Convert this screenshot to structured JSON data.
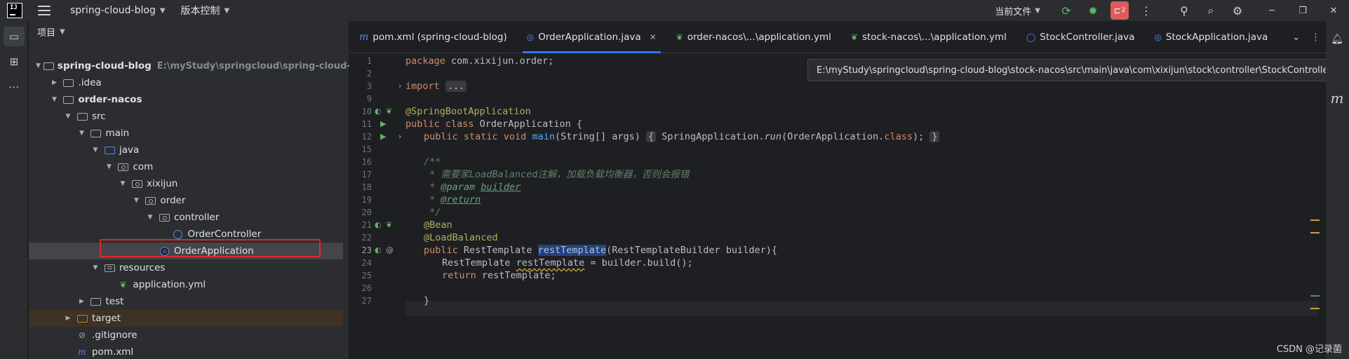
{
  "titlebar": {
    "logo_text": "IJ",
    "project_menu": "spring-cloud-blog",
    "vcs_menu": "版本控制",
    "run_config": "当前文件",
    "problems_badge": "2",
    "icons": [
      "menu-icon",
      "run-icon",
      "debug-icon",
      "more-icon",
      "add-user-icon",
      "search-icon",
      "settings-icon"
    ]
  },
  "project_panel": {
    "header": "项目",
    "tree": [
      {
        "label": "spring-cloud-blog",
        "secondary": "E:\\myStudy\\springcloud\\spring-cloud-blog",
        "depth": 0,
        "expanded": true,
        "icon": "module-folder-icon",
        "bold": true
      },
      {
        "label": ".idea",
        "depth": 1,
        "expanded": false,
        "icon": "folder-icon"
      },
      {
        "label": "order-nacos",
        "depth": 1,
        "expanded": true,
        "icon": "module-folder-icon",
        "bold": true
      },
      {
        "label": "src",
        "depth": 2,
        "expanded": true,
        "icon": "folder-icon"
      },
      {
        "label": "main",
        "depth": 3,
        "expanded": true,
        "icon": "folder-icon"
      },
      {
        "label": "java",
        "depth": 4,
        "expanded": true,
        "icon": "source-folder-icon"
      },
      {
        "label": "com",
        "depth": 5,
        "expanded": true,
        "icon": "package-icon"
      },
      {
        "label": "xixijun",
        "depth": 6,
        "expanded": true,
        "icon": "package-icon"
      },
      {
        "label": "order",
        "depth": 7,
        "expanded": true,
        "icon": "package-icon"
      },
      {
        "label": "controller",
        "depth": 8,
        "expanded": true,
        "icon": "package-icon"
      },
      {
        "label": "OrderController",
        "depth": 9,
        "icon": "class-icon"
      },
      {
        "label": "OrderApplication",
        "depth": 8,
        "icon": "spring-class-icon",
        "selected": true
      },
      {
        "label": "resources",
        "depth": 4,
        "expanded": true,
        "icon": "resources-folder-icon"
      },
      {
        "label": "application.yml",
        "depth": 5,
        "icon": "yml-file-icon"
      },
      {
        "label": "test",
        "depth": 3,
        "expanded": false,
        "icon": "folder-icon"
      },
      {
        "label": "target",
        "depth": 2,
        "expanded": false,
        "icon": "excluded-folder-icon",
        "target": true
      },
      {
        "label": ".gitignore",
        "depth": 2,
        "icon": "gitignore-icon"
      },
      {
        "label": "pom.xml",
        "depth": 2,
        "icon": "maven-icon"
      }
    ]
  },
  "tabs": [
    {
      "label": "pom.xml (spring-cloud-blog)",
      "icon": "m"
    },
    {
      "label": "OrderApplication.java",
      "icon": "spring",
      "active": true,
      "closable": true
    },
    {
      "label": "order-nacos\\...\\application.yml",
      "icon": "yml"
    },
    {
      "label": "stock-nacos\\...\\application.yml",
      "icon": "yml"
    },
    {
      "label": "StockController.java",
      "icon": "class"
    },
    {
      "label": "StockApplication.java",
      "icon": "spring"
    }
  ],
  "tooltip": "E:\\myStudy\\springcloud\\spring-cloud-blog\\stock-nacos\\src\\main\\java\\com\\xixijun\\stock\\controller\\StockController.java",
  "gutter_lines": [
    "1",
    "2",
    "3",
    "9",
    "10",
    "11",
    "12",
    "15",
    "16",
    "17",
    "18",
    "19",
    "20",
    "21",
    "22",
    "23",
    "24",
    "25",
    "26",
    "27"
  ],
  "current_line": "23",
  "code": {
    "l1_kw": "package",
    "l1_rest": " com.xixijun.order;",
    "l3_kw": "import",
    "l3_fold": "...",
    "l10": "@SpringBootApplication",
    "l11_kw": "public class",
    "l11_rest": " OrderApplication {",
    "l12_kw": "public static void",
    "l12_fn": "main",
    "l12_args": "(String[] args)",
    "l12_open": "{",
    "l12_body": " SpringApplication.",
    "l12_run": "run",
    "l12_tail": "(OrderApplication.",
    "l12_class": "class",
    "l12_end": "); ",
    "l12_close": "}",
    "l16": "/**",
    "l17": " * 需要家LoadBalanced注解，加载负载均衡器，否则会报错",
    "l18_star": " * ",
    "l18_tag": "@param",
    "l18_name": "builder",
    "l19_star": " * ",
    "l19_tag": "@return",
    "l20": " */",
    "l21": "@Bean",
    "l22": "@LoadBalanced",
    "l23_kw": "public",
    "l23_type": " RestTemplate ",
    "l23_sel": "restTemplate",
    "l23_rest": "(RestTemplateBuilder builder){",
    "l24_type": "RestTemplate ",
    "l24_var": "restTemplate",
    "l24_rest": " = builder.build();",
    "l25_kw": "return",
    "l25_rest": " restTemplate;",
    "l27": "}"
  },
  "right_strip": {
    "notifications_icon": "bell-icon",
    "maven_label": "m"
  },
  "watermark": "CSDN @记录菌"
}
